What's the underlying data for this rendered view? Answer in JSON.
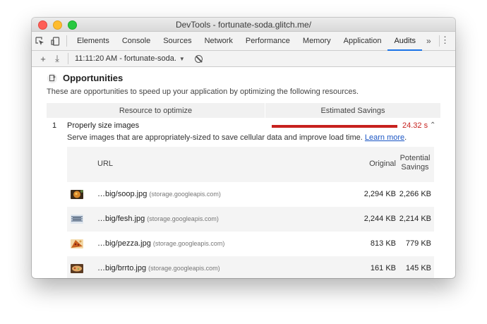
{
  "window": {
    "title": "DevTools - fortunate-soda.glitch.me/"
  },
  "tabs": [
    {
      "label": "Elements"
    },
    {
      "label": "Console"
    },
    {
      "label": "Sources"
    },
    {
      "label": "Network"
    },
    {
      "label": "Performance"
    },
    {
      "label": "Memory"
    },
    {
      "label": "Application"
    },
    {
      "label": "Audits"
    }
  ],
  "tab_more": "»",
  "active_tab": "Audits",
  "kebab": "⋮",
  "toolbar": {
    "add_glyph": "+",
    "download_glyph": "⤓",
    "report_label": "11:11:20 AM - fortunate-soda.",
    "caret": "▼"
  },
  "section": {
    "title": "Opportunities",
    "description": "These are opportunities to speed up your application by optimizing the following resources."
  },
  "table_header": {
    "resource": "Resource to optimize",
    "savings": "Estimated Savings"
  },
  "opportunity": {
    "number": "1",
    "title": "Properly size images",
    "savings": "24.32 s",
    "savings_fraction": 1.0,
    "expand_glyph": "⌃",
    "description": "Serve images that are appropriately-sized to save cellular data and improve load time.",
    "learn_more": "Learn more",
    "period": "."
  },
  "details": {
    "headers": {
      "url": "URL",
      "original": "Original",
      "potential_line1": "Potential",
      "potential_line2": "Savings"
    },
    "rows": [
      {
        "file": "…big/soop.jpg",
        "host": "(storage.googleapis.com)",
        "original": "2,294 KB",
        "savings": "2,266 KB",
        "thumb": "soup-thumbnail"
      },
      {
        "file": "…big/fesh.jpg",
        "host": "(storage.googleapis.com)",
        "original": "2,244 KB",
        "savings": "2,214 KB",
        "thumb": "fish-thumbnail"
      },
      {
        "file": "…big/pezza.jpg",
        "host": "(storage.googleapis.com)",
        "original": "813 KB",
        "savings": "779 KB",
        "thumb": "pizza-thumbnail"
      },
      {
        "file": "…big/brrto.jpg",
        "host": "(storage.googleapis.com)",
        "original": "161 KB",
        "savings": "145 KB",
        "thumb": "burrito-thumbnail"
      }
    ]
  },
  "colors": {
    "accent": "#1a73e8",
    "bad": "#c7221f",
    "link": "#1a55c4"
  }
}
